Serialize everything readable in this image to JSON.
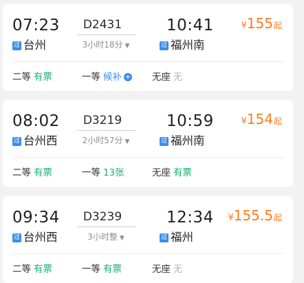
{
  "trains": [
    {
      "dep_time": "07:23",
      "train_no": "D2431",
      "duration": "3小时18分",
      "arr_time": "10:41",
      "dep_tag": "过",
      "dep_station": "台州",
      "arr_tag": "过",
      "arr_station": "福州南",
      "price_symbol": "¥",
      "price": "155",
      "price_suffix": "起",
      "seats": [
        {
          "class": "二等",
          "status": "有票",
          "status_color": "green",
          "has_plus": false
        },
        {
          "class": "一等",
          "status": "候补",
          "status_color": "blue",
          "has_plus": true
        },
        {
          "class": "无座",
          "status": "无",
          "status_color": "gray",
          "has_plus": false
        }
      ]
    },
    {
      "dep_time": "08:02",
      "train_no": "D3219",
      "duration": "2小时57分",
      "arr_time": "10:59",
      "dep_tag": "过",
      "dep_station": "台州西",
      "arr_tag": "过",
      "arr_station": "福州南",
      "price_symbol": "¥",
      "price": "154",
      "price_suffix": "起",
      "seats": [
        {
          "class": "二等",
          "status": "有票",
          "status_color": "green",
          "has_plus": false
        },
        {
          "class": "一等",
          "status": "13张",
          "status_color": "green",
          "has_plus": false
        },
        {
          "class": "无座",
          "status": "有票",
          "status_color": "green",
          "has_plus": false
        }
      ]
    },
    {
      "dep_time": "09:34",
      "train_no": "D3239",
      "duration": "3小时整",
      "arr_time": "12:34",
      "dep_tag": "过",
      "dep_station": "台州西",
      "arr_tag": "过",
      "arr_station": "福州",
      "price_symbol": "¥",
      "price": "155.5",
      "price_suffix": "起",
      "seats": [
        {
          "class": "二等",
          "status": "有票",
          "status_color": "green",
          "has_plus": false
        },
        {
          "class": "一等",
          "status": "有票",
          "status_color": "green",
          "has_plus": false
        },
        {
          "class": "无座",
          "status": "无",
          "status_color": "gray",
          "has_plus": false
        }
      ]
    }
  ],
  "icons": {
    "duration_caret": "chevron-down-icon",
    "plus": "plus-circle-icon",
    "station_tag": "pass-through-tag-icon"
  },
  "colors": {
    "price": "#ff7a1a",
    "available": "#19b071",
    "waitlist": "#3a8bef",
    "unavailable": "#b3b3b3",
    "tag": "#3a8bef"
  }
}
